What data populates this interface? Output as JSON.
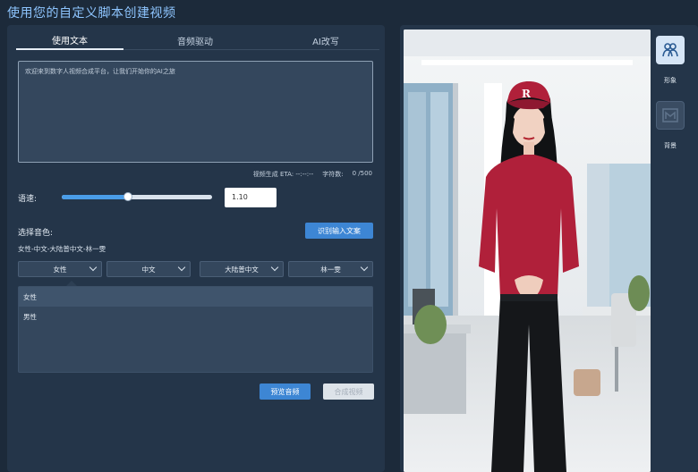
{
  "app": {
    "title": "使用您的自定义脚本创建视频"
  },
  "tabs": [
    {
      "label": "使用文本",
      "active": true
    },
    {
      "label": "音频驱动",
      "active": false
    },
    {
      "label": "AI改写",
      "active": false
    }
  ],
  "script": {
    "text": "欢迎来到数字人视频合成平台，让我们开始你的AI之旅"
  },
  "meta": {
    "eta_label": "视频生成 ETA: --:--:--",
    "chars_label": "字符数:",
    "chars_value": "0 /500"
  },
  "speed": {
    "label": "语速:",
    "value": "1.10",
    "fraction": 0.44
  },
  "voice": {
    "label": "选择音色:",
    "recognize_label": "识别输入文案",
    "selected_desc": "女性-中文-大陆普中文-林一雯",
    "dropdowns": [
      "女性",
      "中文",
      "大陆普中文",
      "林一雯"
    ],
    "options": [
      "女性",
      "男性"
    ]
  },
  "actions": {
    "preview_label": "预览音频",
    "compose_label": "合成视频"
  },
  "sidebar": {
    "avatar_label": "形象",
    "background_label": "背景"
  },
  "colors": {
    "accent": "#3d86d4",
    "title": "#8ec5ff",
    "panel": "#243549",
    "app_bg": "#1c2a3a",
    "shirt": "#b0203a"
  }
}
